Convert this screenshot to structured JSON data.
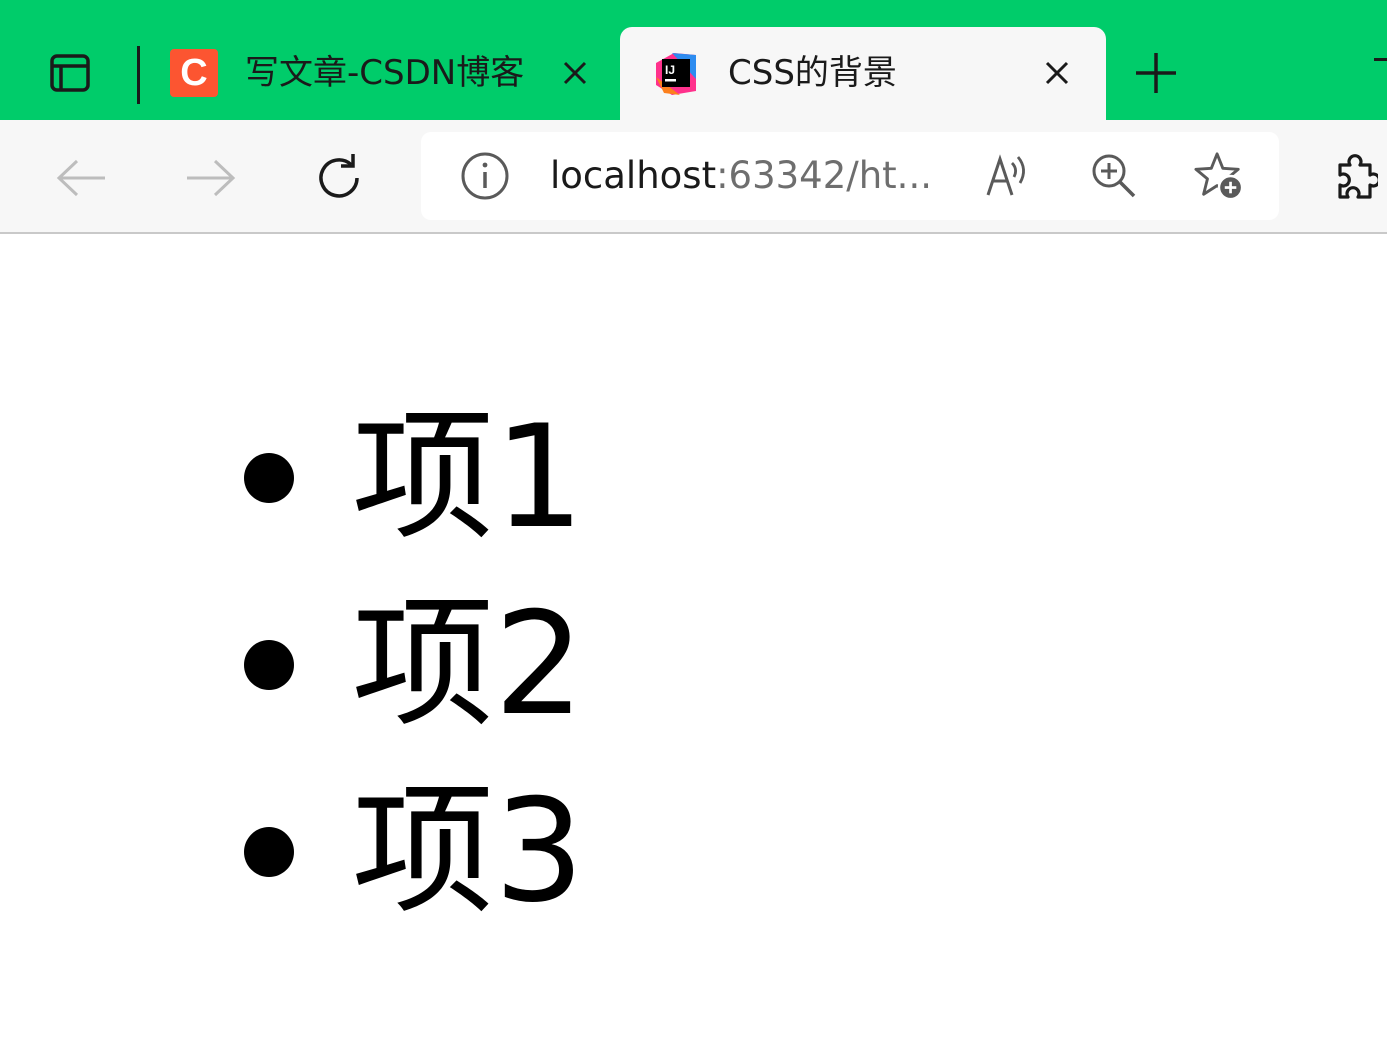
{
  "browser": {
    "tabs": [
      {
        "title": "写文章-CSDN博客",
        "favicon_letter": "C",
        "active": false
      },
      {
        "title": "CSS的背景",
        "favicon_letter": "IJ",
        "active": true
      }
    ],
    "address_bar": {
      "url_host": "localhost",
      "url_rest": ":63342/ht..."
    },
    "colors": {
      "tabstrip": "#00cc6a",
      "csdn_favicon": "#fc5531",
      "toolbar": "#f7f7f7"
    },
    "icons": {
      "tab_actions": "tab-actions-icon",
      "close": "close-icon",
      "new_tab": "plus-icon",
      "back": "back-arrow-icon",
      "forward": "forward-arrow-icon",
      "refresh": "refresh-icon",
      "site_info": "info-icon",
      "read_aloud": "read-aloud-icon",
      "zoom": "zoom-in-icon",
      "favorites": "add-favorite-icon",
      "extensions": "puzzle-icon"
    }
  },
  "page": {
    "list_items": [
      "项1",
      "项2",
      "项3"
    ]
  }
}
